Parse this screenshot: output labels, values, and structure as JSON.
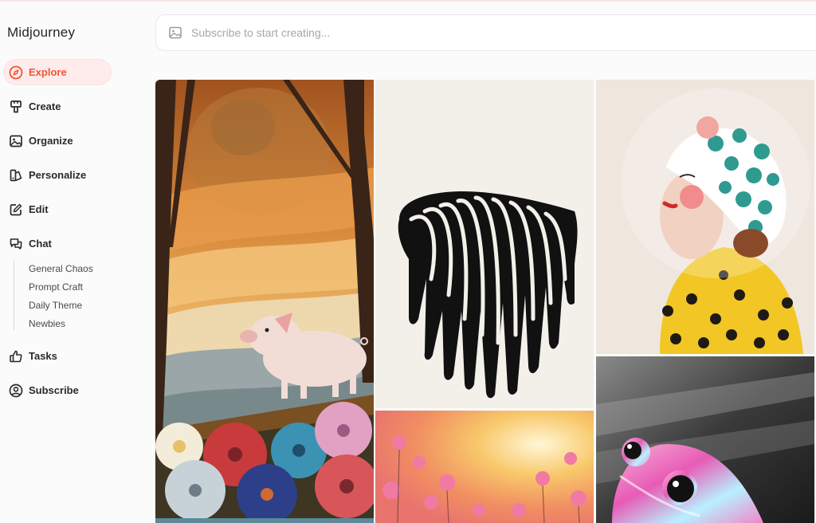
{
  "app": {
    "title": "Midjourney"
  },
  "nav": {
    "items": [
      {
        "label": "Explore",
        "icon": "compass-icon",
        "active": true
      },
      {
        "label": "Create",
        "icon": "paintbrush-icon"
      },
      {
        "label": "Organize",
        "icon": "image-icon"
      },
      {
        "label": "Personalize",
        "icon": "palette-icon"
      },
      {
        "label": "Edit",
        "icon": "edit-icon"
      },
      {
        "label": "Chat",
        "icon": "chat-icon"
      },
      {
        "label": "Tasks",
        "icon": "thumbs-up-icon"
      },
      {
        "label": "Subscribe",
        "icon": "user-circle-icon"
      }
    ],
    "chat_channels": [
      "General Chaos",
      "Prompt Craft",
      "Daily Theme",
      "Newbies"
    ]
  },
  "search": {
    "placeholder": "Subscribe to start creating...",
    "value": ""
  },
  "colors": {
    "accent": "#f05537",
    "accent_bg": "#fdeceb"
  },
  "gallery": {
    "images": [
      {
        "name": "pig-in-autumn-landscape"
      },
      {
        "name": "dripping-striped-shape"
      },
      {
        "name": "woman-in-polka-dot-helmet"
      },
      {
        "name": "pink-flowers-sunset"
      },
      {
        "name": "iridescent-pink-frog"
      }
    ]
  }
}
